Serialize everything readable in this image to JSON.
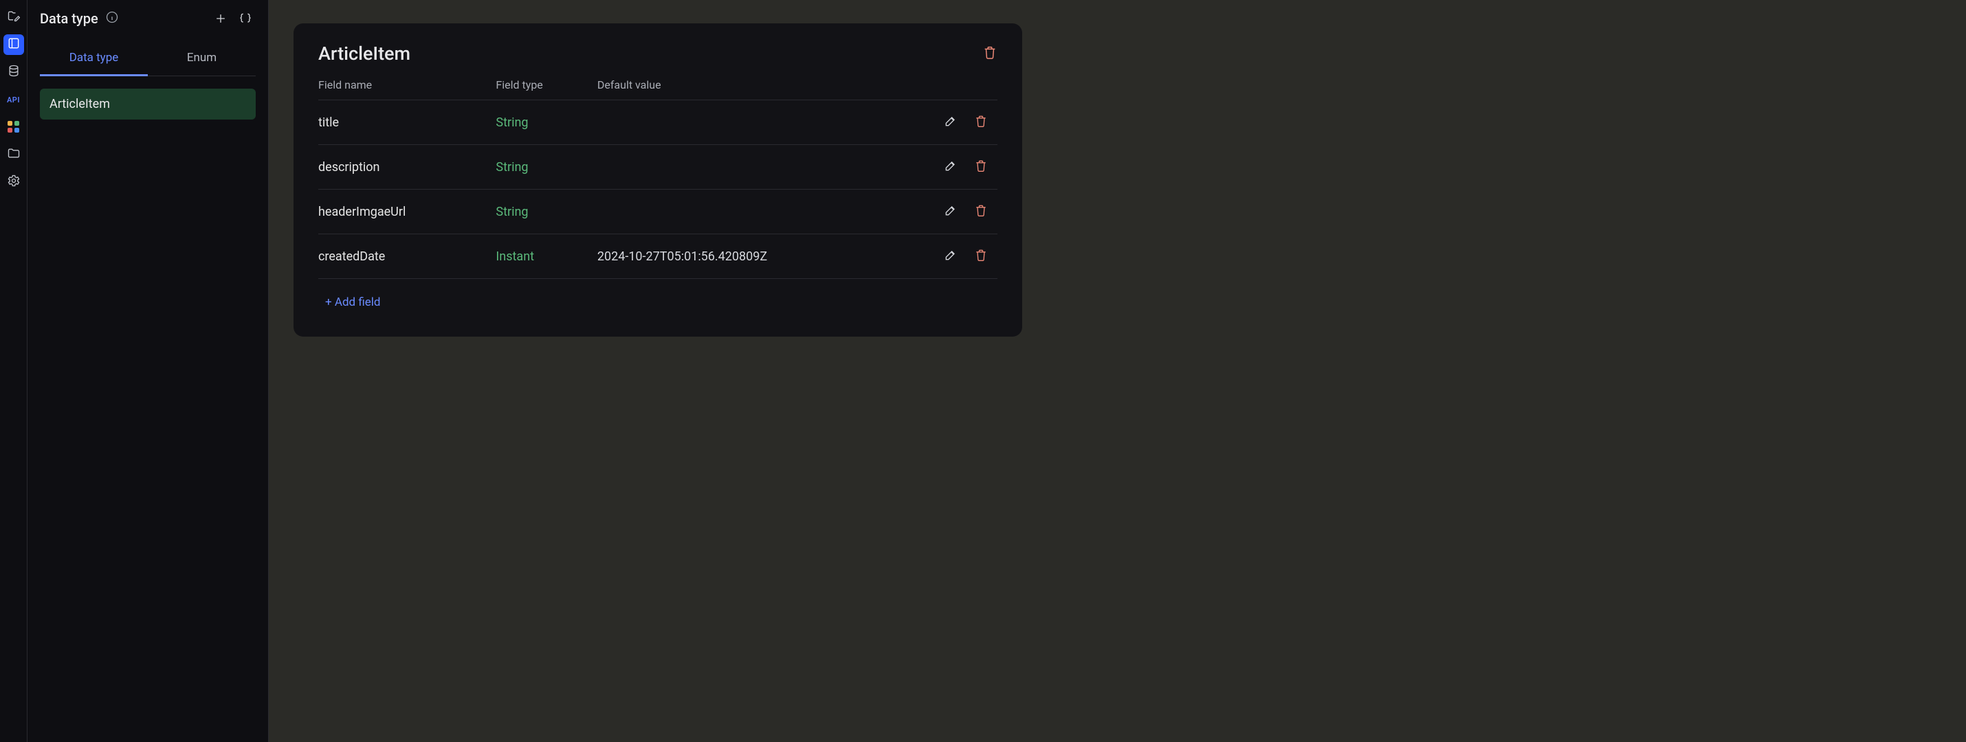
{
  "sidebar": {
    "title": "Data type",
    "tabs": {
      "data_type": "Data type",
      "enum": "Enum"
    },
    "items": [
      {
        "label": "ArticleItem"
      }
    ]
  },
  "rail": {
    "api_label": "API",
    "grid_colors": [
      "#f0b34a",
      "#5ab87a",
      "#e05a5a",
      "#4a8ef0"
    ]
  },
  "detail": {
    "title": "ArticleItem",
    "headers": {
      "name": "Field name",
      "type": "Field type",
      "default": "Default value"
    },
    "add_field_label": "+ Add field",
    "fields": [
      {
        "name": "title",
        "type": "String",
        "default": ""
      },
      {
        "name": "description",
        "type": "String",
        "default": ""
      },
      {
        "name": "headerImgaeUrl",
        "type": "String",
        "default": ""
      },
      {
        "name": "createdDate",
        "type": "Instant",
        "default": "2024-10-27T05:01:56.420809Z"
      }
    ]
  }
}
